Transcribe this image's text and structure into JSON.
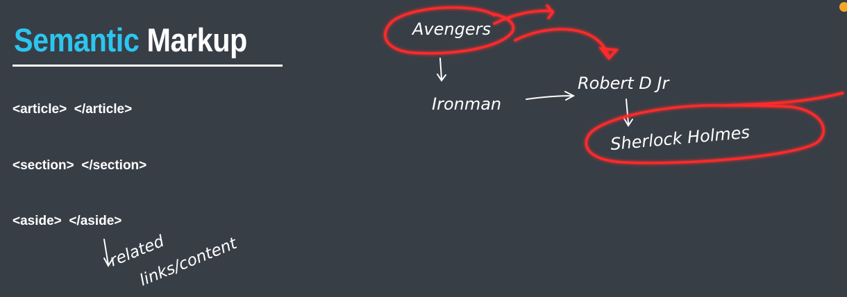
{
  "slide": {
    "title_accent": "Semantic",
    "title_rest": "Markup",
    "tags": [
      "<article>  </article>",
      "<section>  </section>",
      "<aside>  </aside>"
    ]
  },
  "annotations": {
    "aside_note_line1": "related",
    "aside_note_line2": "links/content",
    "avengers": "Avengers",
    "ironman": "Ironman",
    "robert": "Robert D Jr",
    "sherlock": "Sherlock Holmes"
  },
  "colors": {
    "accent": "#2bc6f0",
    "background": "#383e46",
    "highlight": "#ff2a2a"
  }
}
